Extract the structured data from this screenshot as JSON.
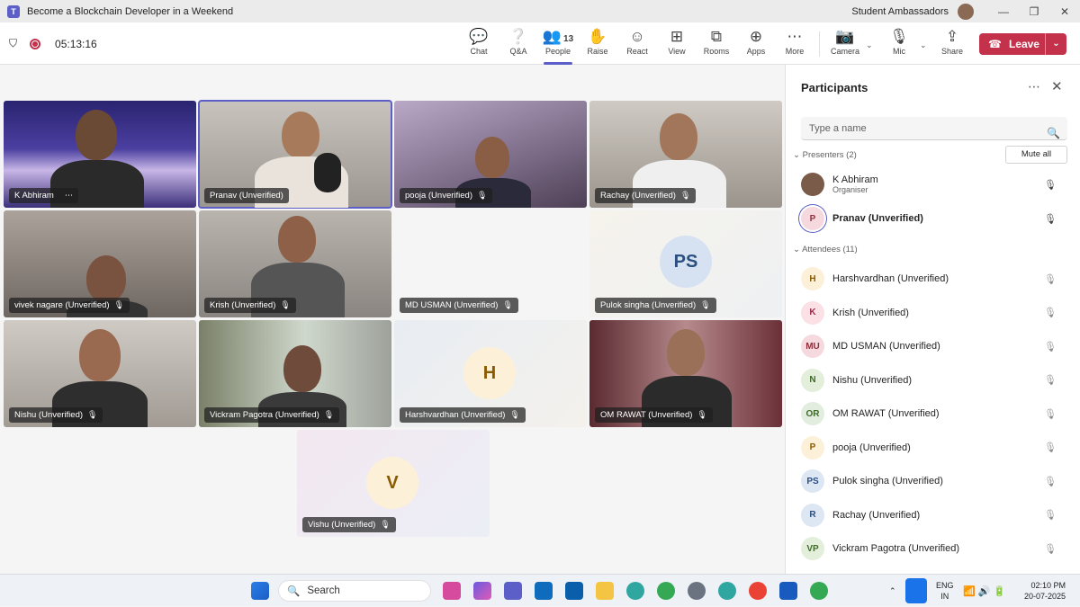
{
  "window": {
    "title": "Become a Blockchain Developer in a Weekend",
    "org": "Student Ambassadors",
    "controls": [
      "—",
      "❐",
      "✕"
    ]
  },
  "toolbar": {
    "timer": "05:13:16",
    "people_count": "13",
    "buttons": [
      {
        "label": "Chat",
        "icon": "💬"
      },
      {
        "label": "Q&A",
        "icon": "❔"
      },
      {
        "label": "People",
        "icon": "👥"
      },
      {
        "label": "Raise",
        "icon": "✋"
      },
      {
        "label": "React",
        "icon": "☺"
      },
      {
        "label": "View",
        "icon": "⊞"
      },
      {
        "label": "Rooms",
        "icon": "⧉"
      },
      {
        "label": "Apps",
        "icon": "⊕"
      },
      {
        "label": "More",
        "icon": "⋯"
      },
      {
        "label": "Camera",
        "icon": "📷"
      },
      {
        "label": "Mic",
        "icon": "🎙"
      },
      {
        "label": "Share",
        "icon": "⇪"
      }
    ],
    "leave": "Leave"
  },
  "tiles": [
    {
      "name": "K Abhiram",
      "extra": "⋯"
    },
    {
      "name": "Pranav (Unverified)"
    },
    {
      "name": "pooja (Unverified)"
    },
    {
      "name": "Rachay (Unverified)"
    },
    {
      "name": "vivek nagare (Unverified)"
    },
    {
      "name": "Krish (Unverified)"
    },
    {
      "name": "MD USMAN (Unverified)"
    },
    {
      "name": "Pulok singha (Unverified)",
      "initials": "PS"
    },
    {
      "name": "Nishu (Unverified)"
    },
    {
      "name": "Vickram Pagotra (Unverified)"
    },
    {
      "name": "Harshvardhan (Unverified)",
      "initials": "H"
    },
    {
      "name": "OM RAWAT (Unverified)"
    },
    {
      "name": "Vishu (Unverified)",
      "initials": "V"
    }
  ],
  "panel": {
    "title": "Participants",
    "more": "⋯",
    "close": "✕",
    "search_placeholder": "Type a name",
    "mute_all": "Mute all",
    "presenters_label": "Presenters (2)",
    "attendees_label": "Attendees (11)",
    "presenters": [
      {
        "name": "K Abhiram",
        "role": "Organiser",
        "initials": ""
      },
      {
        "name": "Pranav (Unverified)",
        "initials": "P"
      }
    ],
    "attendees": [
      {
        "name": "Harshvardhan (Unverified)",
        "initials": "H",
        "color": "#fdf0d8",
        "fg": "#8a5a00"
      },
      {
        "name": "Krish (Unverified)",
        "initials": "K",
        "color": "#fbe0e6",
        "fg": "#9a2a45"
      },
      {
        "name": "MD USMAN (Unverified)",
        "initials": "MU",
        "color": "#f6d9de",
        "fg": "#8e2f3c"
      },
      {
        "name": "Nishu (Unverified)",
        "initials": "N",
        "color": "#e3eedb",
        "fg": "#3f6a2a"
      },
      {
        "name": "OM RAWAT (Unverified)",
        "initials": "OR",
        "color": "#e2ecdf",
        "fg": "#3f6a2a"
      },
      {
        "name": "pooja (Unverified)",
        "initials": "P",
        "color": "#fdf0d8",
        "fg": "#8a5a00"
      },
      {
        "name": "Pulok singha (Unverified)",
        "initials": "PS",
        "color": "#dde6f3",
        "fg": "#2b4f80"
      },
      {
        "name": "Rachay (Unverified)",
        "initials": "R",
        "color": "#dde6f3",
        "fg": "#2b4f80"
      },
      {
        "name": "Vickram Pagotra (Unverified)",
        "initials": "VP",
        "color": "#e3eedb",
        "fg": "#3f6a2a"
      }
    ]
  },
  "taskbar": {
    "search": "Search",
    "lang": "ENG",
    "region": "IN",
    "time": "02:10 PM",
    "date": "20-07-2025"
  }
}
